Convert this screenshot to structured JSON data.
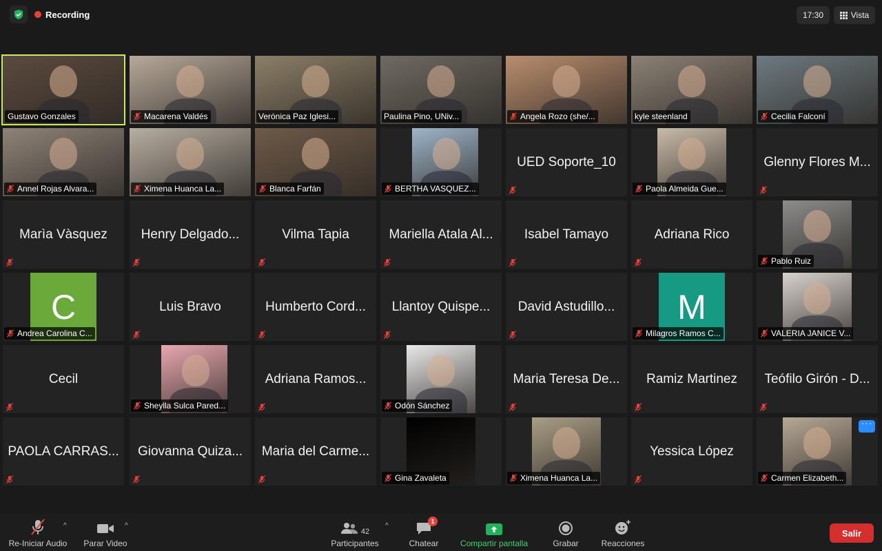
{
  "topbar": {
    "recording_label": "Recording",
    "clock": "17:30",
    "view_label": "Vista"
  },
  "colors": {
    "background": "#1a1a1a",
    "tile": "#232323",
    "active_border": "#c8e866",
    "recording_dot": "#e8403a",
    "leave_button": "#d42e2e",
    "share_accent": "#3dd26d",
    "more_button": "#2d8cff"
  },
  "participants": [
    {
      "name": "Gustavo Gonzales",
      "type": "video",
      "active": true,
      "muted": false,
      "tone": "#5b4a3e"
    },
    {
      "name": "Macarena Valdés",
      "type": "video",
      "muted": true,
      "tone": "#b7a99a"
    },
    {
      "name": "Verónica Paz Iglesi...",
      "type": "video",
      "muted": false,
      "tone": "#8c7f68"
    },
    {
      "name": "Paulina Pino, UNiv...",
      "type": "video",
      "muted": false,
      "tone": "#6f6a62"
    },
    {
      "name": "Angela Rozo (she/...",
      "type": "video",
      "muted": true,
      "tone": "#b98d6e"
    },
    {
      "name": "kyle steenland",
      "type": "video",
      "muted": false,
      "tone": "#8b8175"
    },
    {
      "name": "Cecilia Falconí",
      "type": "video",
      "muted": true,
      "tone": "#6d7a80"
    },
    {
      "name": "Annel Rojas Alvara...",
      "type": "video",
      "muted": true,
      "tone": "#8e8378"
    },
    {
      "name": "Ximena Huanca La...",
      "type": "video",
      "muted": true,
      "tone": "#b5aea1"
    },
    {
      "name": "Blanca Farfán",
      "type": "video",
      "muted": true,
      "tone": "#6e5a48"
    },
    {
      "name": "BERTHA VASQUEZ...",
      "type": "image",
      "muted": true,
      "tone": "#9eb4c9",
      "width": "mid"
    },
    {
      "name": "UED Soporte_10",
      "type": "name",
      "muted": true
    },
    {
      "name": "Paola Almeida Gue...",
      "type": "image",
      "muted": true,
      "tone": "#c9bba9",
      "width": "narrow"
    },
    {
      "name": "Glenny Flores M...",
      "type": "name",
      "muted": true
    },
    {
      "name": "Marìa Vàsquez",
      "type": "name",
      "muted": true
    },
    {
      "name": "Henry Delgado...",
      "type": "name",
      "muted": true
    },
    {
      "name": "Vilma Tapia",
      "type": "name",
      "muted": true
    },
    {
      "name": "Mariella Atala Al...",
      "type": "name",
      "muted": true
    },
    {
      "name": "Isabel Tamayo",
      "type": "name",
      "muted": true
    },
    {
      "name": "Adriana Rico",
      "type": "name",
      "muted": true
    },
    {
      "name": "Pablo Ruiz",
      "type": "image",
      "muted": true,
      "tone": "#8c8c8a",
      "width": "narrow"
    },
    {
      "name": "Andrea Carolina C...",
      "type": "letter",
      "letter": "C",
      "muted": true,
      "tone": "#6aaa3a"
    },
    {
      "name": "Luis Bravo",
      "type": "name",
      "muted": true
    },
    {
      "name": "Humberto Cord...",
      "type": "name",
      "muted": true
    },
    {
      "name": "Llantoy Quispe...",
      "type": "name",
      "muted": true
    },
    {
      "name": "David Astudillo...",
      "type": "name",
      "muted": true
    },
    {
      "name": "Milagros Ramos C...",
      "type": "letter",
      "letter": "M",
      "muted": true,
      "tone": "#169a84"
    },
    {
      "name": "VALERIA JANICE V...",
      "type": "image",
      "muted": true,
      "tone": "#d8d2cd",
      "width": "narrow"
    },
    {
      "name": "Cecil",
      "type": "name",
      "muted": true
    },
    {
      "name": "Sheylla Sulca Pared...",
      "type": "image",
      "muted": true,
      "tone": "#e8a7b0",
      "width": "mid"
    },
    {
      "name": "Adriana Ramos...",
      "type": "name",
      "muted": true
    },
    {
      "name": "Odón Sánchez",
      "type": "image",
      "muted": true,
      "tone": "#e9e9e9",
      "width": "narrow"
    },
    {
      "name": "Maria Teresa De...",
      "type": "name",
      "muted": true
    },
    {
      "name": "Ramiz Martinez",
      "type": "name",
      "muted": true
    },
    {
      "name": "Teófilo Girón - D...",
      "type": "name",
      "muted": true
    },
    {
      "name": "PAOLA CARRAS...",
      "type": "name",
      "muted": true
    },
    {
      "name": "Giovanna Quiza...",
      "type": "name",
      "muted": true
    },
    {
      "name": "Maria del Carme...",
      "type": "name",
      "muted": true
    },
    {
      "name": "Gina Zavaleta",
      "type": "image",
      "muted": true,
      "tone": "#000000",
      "width": "narrow"
    },
    {
      "name": "Ximena Huanca La...",
      "type": "image",
      "muted": true,
      "tone": "#a99e86",
      "width": "narrow"
    },
    {
      "name": "Yessica López",
      "type": "name",
      "muted": true
    },
    {
      "name": "Carmen Elizabeth...",
      "type": "image",
      "muted": true,
      "tone": "#b7a896",
      "width": "narrow",
      "more": true
    }
  ],
  "toolbar": {
    "audio_label": "Re-Iniciar Audio",
    "video_label": "Parar Video",
    "participants_label": "Participantes",
    "participants_count": "42",
    "chat_label": "Chatear",
    "chat_badge": "1",
    "share_label": "Compartir pantalla",
    "record_label": "Grabar",
    "reactions_label": "Reacciones",
    "leave_label": "Salir"
  }
}
